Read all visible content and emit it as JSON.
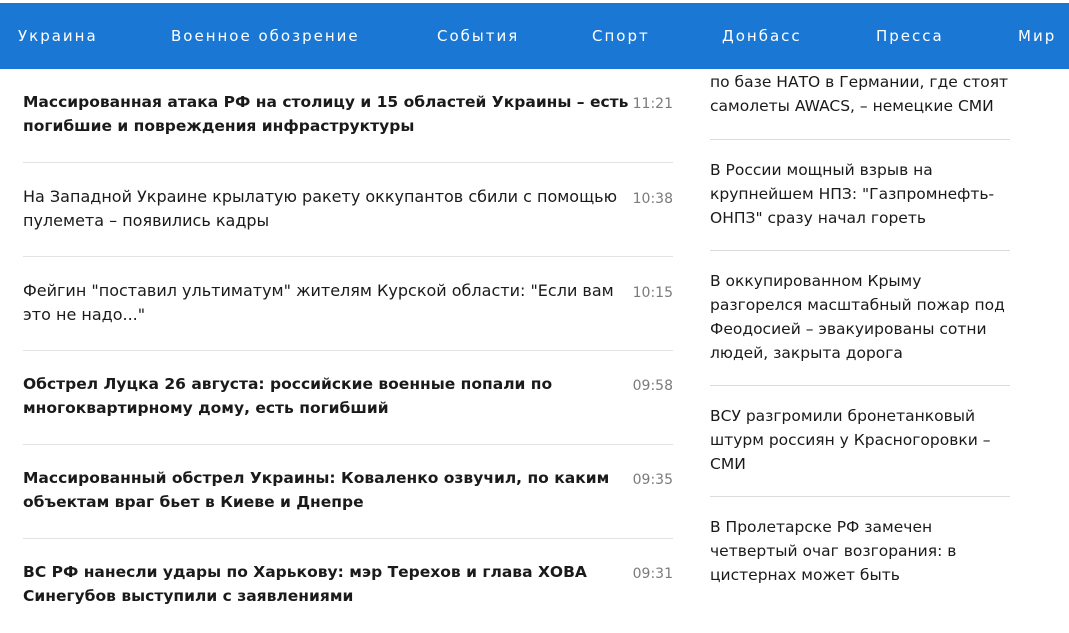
{
  "nav": {
    "items": [
      {
        "label": "Украина"
      },
      {
        "label": "Военное обозрение"
      },
      {
        "label": "События"
      },
      {
        "label": "Спорт"
      },
      {
        "label": "Донбасс"
      },
      {
        "label": "Пресса"
      },
      {
        "label": "Мир"
      }
    ]
  },
  "news": [
    {
      "title": "Массированная атака РФ на столицу и 15 областей Украины – есть погибшие и повреждения инфраструктуры",
      "time": "11:21",
      "bold": true
    },
    {
      "title": "На Западной Украине крылатую ракету оккупантов сбили с помощью пулемета – появились кадры",
      "time": "10:38",
      "bold": false
    },
    {
      "title": "Фейгин \"поставил ультиматум\" жителям Курской области: \"Если вам это не надо...\"",
      "time": "10:15",
      "bold": false
    },
    {
      "title": "Обстрел Луцка 26 августа: российские военные попали по многоквартирному дому, есть погибший",
      "time": "09:58",
      "bold": true
    },
    {
      "title": "Массированный обстрел Украины: Коваленко озвучил, по каким объектам враг бьет в Киеве и Днепре",
      "time": "09:35",
      "bold": true
    },
    {
      "title": "ВС РФ нанесли удары по Харькову: мэр Терехов и глава ХОВА Синегубов выступили с заявлениями",
      "time": "09:31",
      "bold": true
    }
  ],
  "sidebar": [
    {
      "title": "по базе НАТО в Германии, где стоят самолеты AWACS, – немецкие СМИ"
    },
    {
      "title": "В России мощный взрыв на крупнейшем НПЗ: \"Газпромнефть-ОНПЗ\" сразу начал гореть"
    },
    {
      "title": "В оккупированном Крыму разгорелся масштабный пожар под Феодосией – эвакуированы сотни людей, закрыта дорога"
    },
    {
      "title": "ВСУ разгромили бронетанковый штурм россиян у Красногоровки – СМИ"
    },
    {
      "title": "В Пролетарске РФ замечен четвертый очаг возгорания: в цистернах может быть"
    }
  ]
}
